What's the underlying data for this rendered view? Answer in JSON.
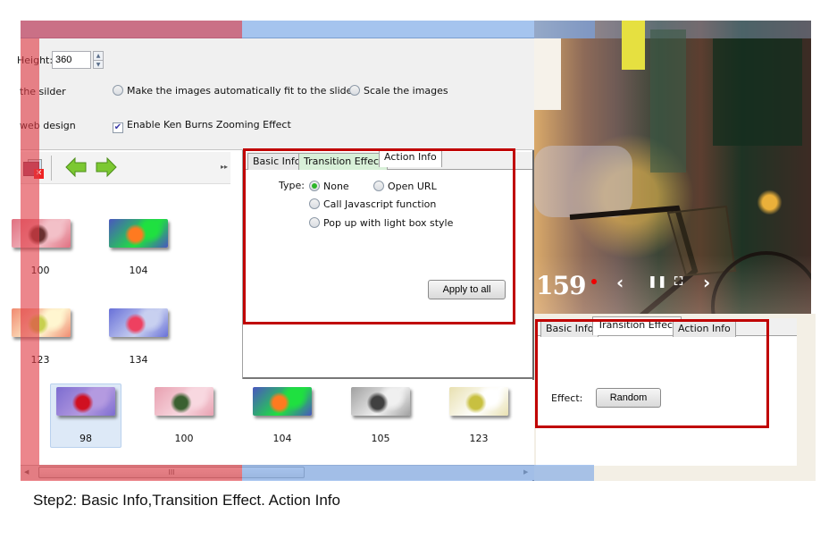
{
  "settings": {
    "height_label": "Height:",
    "height_value": "360",
    "fit_label_partial": "the silder",
    "fit_option": "Make the images automatically fit to the slider",
    "scale_option": "Scale the images",
    "webdesign_label_partial": "web design",
    "kenburns_label": "Enable Ken Burns Zooming Effect",
    "kenburns_checked": true
  },
  "toolbar": {
    "icons": [
      "delete-image-icon",
      "move-left-arrow-icon",
      "move-right-arrow-icon",
      "more-icon"
    ]
  },
  "left_grid": {
    "items": [
      {
        "caption": "100",
        "colors": [
          "#e07080",
          "#f3c0c8",
          "#6a3030"
        ]
      },
      {
        "caption": "104",
        "colors": [
          "#4a56c0",
          "#1fe040",
          "#ff7a20"
        ]
      },
      {
        "caption": "123",
        "colors": [
          "#f08a70",
          "#fff6d0",
          "#c8d050"
        ]
      },
      {
        "caption": "134",
        "colors": [
          "#6870d8",
          "#c8d0f0",
          "#ee4060"
        ]
      }
    ]
  },
  "action_panel": {
    "tabs": [
      {
        "label": "Basic Info",
        "active": false
      },
      {
        "label": "Transition Effect",
        "active": false
      },
      {
        "label": "Action Info",
        "active": true
      }
    ],
    "type_label": "Type:",
    "options": [
      {
        "label": "None",
        "selected": true
      },
      {
        "label": "Open URL",
        "selected": false
      },
      {
        "label": "Call Javascript function",
        "selected": false
      },
      {
        "label": "Pop up with light box style",
        "selected": false
      }
    ],
    "apply_button": "Apply to all"
  },
  "bottom_strip": {
    "items": [
      {
        "caption": "98",
        "selected": true,
        "colors": [
          "#7c6cd0",
          "#b49ae0",
          "#d01020"
        ]
      },
      {
        "caption": "100",
        "selected": false,
        "colors": [
          "#e8a0b0",
          "#f8d8e0",
          "#3a6030"
        ]
      },
      {
        "caption": "104",
        "selected": false,
        "colors": [
          "#4a56c0",
          "#1fe040",
          "#ff7a20"
        ]
      },
      {
        "caption": "105",
        "selected": false,
        "colors": [
          "#a0a0a0",
          "#f0f0f0",
          "#404040"
        ]
      },
      {
        "caption": "123",
        "selected": false,
        "colors": [
          "#e8e0b0",
          "#ffffff",
          "#c8c040"
        ]
      }
    ],
    "scrollbar_grip": "III"
  },
  "preview": {
    "counter": "159",
    "controls": [
      "prev-icon",
      "pause-icon",
      "fullscreen-icon",
      "next-icon"
    ]
  },
  "transition_panel": {
    "tabs": [
      {
        "label": "Basic Info",
        "active": false
      },
      {
        "label": "Transition Effect",
        "active": true
      },
      {
        "label": "Action Info",
        "active": false
      }
    ],
    "effect_label": "Effect:",
    "effect_button": "Random"
  },
  "caption": "Step2: Basic Info,Transition Effect. Action Info",
  "colors": {
    "highlight_red": "#c00000",
    "overlay_red": "#e03c46",
    "overlay_blue": "#78a5e6",
    "radio_selected": "#2db62a"
  }
}
